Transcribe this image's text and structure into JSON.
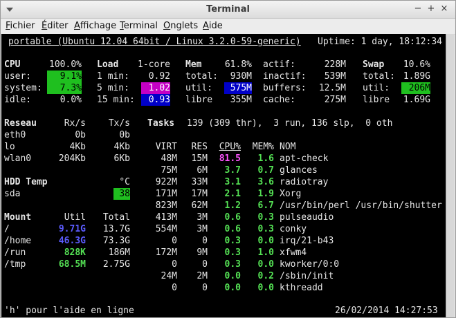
{
  "window": {
    "title": "Terminal",
    "minimize": "−",
    "maximize": "+",
    "close": "×"
  },
  "menu": [
    "Fichier",
    "Éditer",
    "Affichage",
    "Terminal",
    "Onglets",
    "Aide"
  ],
  "header": {
    "host": "portable (Ubuntu 12.04 64bit / Linux 3.2.0-59-generic)",
    "uptime": "Uptime: 1 day, 18:12:34"
  },
  "cpu": {
    "label": "CPU",
    "total": "100.0%",
    "user_label": "user:",
    "user": "9.1%",
    "system_label": "system:",
    "system": "7.3%",
    "idle_label": "idle:",
    "idle": "0.0%"
  },
  "load": {
    "label": "Load",
    "cores": "1-core",
    "min1_label": "1 min:",
    "min1": "0.92",
    "min5_label": "5 min:",
    "min5": "1.02",
    "min15_label": "15 min:",
    "min15": "0.93"
  },
  "mem": {
    "label": "Mem",
    "pct": "61.8%",
    "total_label": "total:",
    "total": "930M",
    "util_label": "util:",
    "util": "575M",
    "libre_label": "libre",
    "libre": "355M",
    "actif_label": "actif:",
    "actif": "228M",
    "inactif_label": "inactif:",
    "inactif": "539M",
    "buffers_label": "buffers:",
    "buffers": "12.5M",
    "cache_label": "cache:",
    "cache": "275M"
  },
  "swap": {
    "label": "Swap",
    "pct": "10.6%",
    "total_label": "total:",
    "total": "1.89G",
    "util_label": "util:",
    "util": "206M",
    "libre_label": "libre",
    "libre": "1.69G"
  },
  "network": {
    "label": "Reseau",
    "rx": "Rx/s",
    "tx": "Tx/s",
    "rows": [
      [
        "eth0",
        "0b",
        "0b"
      ],
      [
        "lo",
        "4Kb",
        "4Kb"
      ],
      [
        "wlan0",
        "204Kb",
        "6Kb"
      ]
    ]
  },
  "tasks": {
    "label": "Tasks",
    "summary": "139 (309 thr),  3 run, 136 slp,  0 oth"
  },
  "proc_headers": {
    "virt": "VIRT",
    "res": "RES",
    "cpu": "CPU%",
    "mem": "MEM%",
    "name": "NOM"
  },
  "processes": [
    {
      "virt": "48M",
      "res": "15M",
      "cpu": "81.5",
      "mem": "1.6",
      "name": "apt-check"
    },
    {
      "virt": "75M",
      "res": "6M",
      "cpu": "3.7",
      "mem": "0.7",
      "name": "glances"
    },
    {
      "virt": "922M",
      "res": "33M",
      "cpu": "3.1",
      "mem": "3.6",
      "name": "radiotray"
    },
    {
      "virt": "171M",
      "res": "17M",
      "cpu": "2.1",
      "mem": "1.9",
      "name": "Xorg"
    },
    {
      "virt": "823M",
      "res": "62M",
      "cpu": "1.2",
      "mem": "6.7",
      "name": "/usr/bin/perl /usr/bin/shutter"
    },
    {
      "virt": "413M",
      "res": "3M",
      "cpu": "0.6",
      "mem": "0.3",
      "name": "pulseaudio"
    },
    {
      "virt": "554M",
      "res": "3M",
      "cpu": "0.6",
      "mem": "0.3",
      "name": "conky"
    },
    {
      "virt": "0",
      "res": "0",
      "cpu": "0.3",
      "mem": "0.0",
      "name": "irq/21-b43"
    },
    {
      "virt": "172M",
      "res": "9M",
      "cpu": "0.3",
      "mem": "1.0",
      "name": "xfwm4"
    },
    {
      "virt": "0",
      "res": "0",
      "cpu": "0.3",
      "mem": "0.0",
      "name": "kworker/0:0"
    },
    {
      "virt": "24M",
      "res": "2M",
      "cpu": "0.0",
      "mem": "0.2",
      "name": "/sbin/init"
    },
    {
      "virt": "0",
      "res": "0",
      "cpu": "0.0",
      "mem": "0.0",
      "name": "kthreadd"
    }
  ],
  "hdd": {
    "label": "HDD Temp",
    "unit": "°C",
    "sensor": "sda",
    "value": "38"
  },
  "mount": {
    "label": "Mount",
    "util": "Util",
    "total": "Total",
    "rows": [
      [
        "/",
        "9.71G",
        "13.7G"
      ],
      [
        "/home",
        "46.3G",
        "73.3G"
      ],
      [
        "/run",
        "828K",
        "186M"
      ],
      [
        "/tmp",
        "68.5M",
        "2.75G"
      ]
    ]
  },
  "footer": {
    "help": "'h' pour l'aide en ligne",
    "datetime": "26/02/2014 14:27:53"
  }
}
